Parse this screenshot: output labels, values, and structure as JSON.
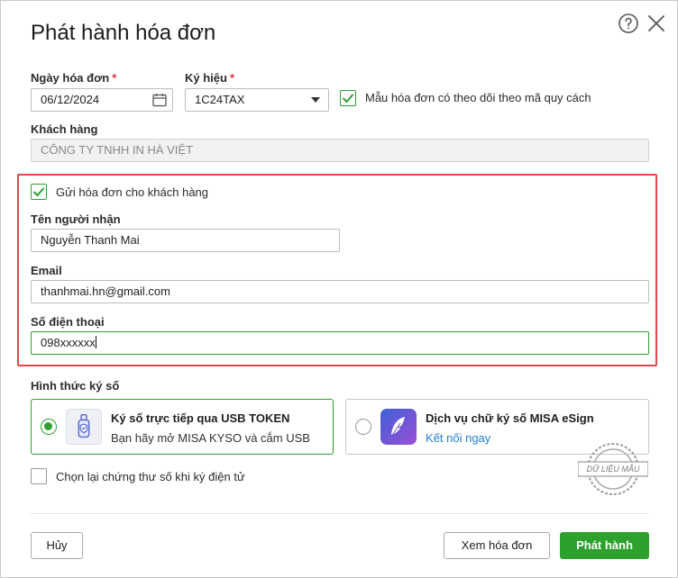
{
  "dialog": {
    "title": "Phát hành hóa đơn"
  },
  "fields": {
    "invoice_date_label": "Ngày hóa đơn",
    "invoice_date_value": "06/12/2024",
    "symbol_label": "Ký hiệu",
    "symbol_value": "1C24TAX",
    "required_mark": "*",
    "template_tracking_label": "Mẫu hóa đơn có theo dõi theo mã quy cách",
    "customer_label": "Khách hàng",
    "customer_value": "CÔNG TY TNHH IN HÀ VIỆT"
  },
  "send_section": {
    "send_checkbox_label": "Gửi hóa đơn cho khách hàng",
    "recipient_label": "Tên người nhận",
    "recipient_value": "Nguyễn Thanh Mai",
    "email_label": "Email",
    "email_value": "thanhmai.hn@gmail.com",
    "phone_label": "Số điện thoại",
    "phone_value": "098xxxxxx"
  },
  "signing": {
    "section_label": "Hình thức ký số",
    "option_usb_title": "Ký số trực tiếp qua USB TOKEN",
    "option_usb_sub": "Bạn hãy mở MISA KYSO và cắm USB",
    "option_esign_title": "Dịch vụ chữ ký số MISA eSign",
    "option_esign_link": "Kết nối ngay",
    "reselect_label": "Chọn lại chứng thư số khi ký điện tử"
  },
  "watermark": {
    "text": "DỮ LIỆU MẪU"
  },
  "footer": {
    "cancel_label": "Hủy",
    "view_invoice_label": "Xem hóa đơn",
    "publish_label": "Phát hành"
  },
  "colors": {
    "accent_green": "#2ea02e",
    "highlight_red": "#e04848",
    "link_blue": "#1e7fd6",
    "required_red": "#e0343b"
  },
  "icons": {
    "help": "question-circle-icon",
    "close": "close-icon",
    "calendar": "calendar-icon",
    "dropdown": "caret-down-icon",
    "usb": "usb-token-icon",
    "esign": "feather-pen-icon"
  }
}
